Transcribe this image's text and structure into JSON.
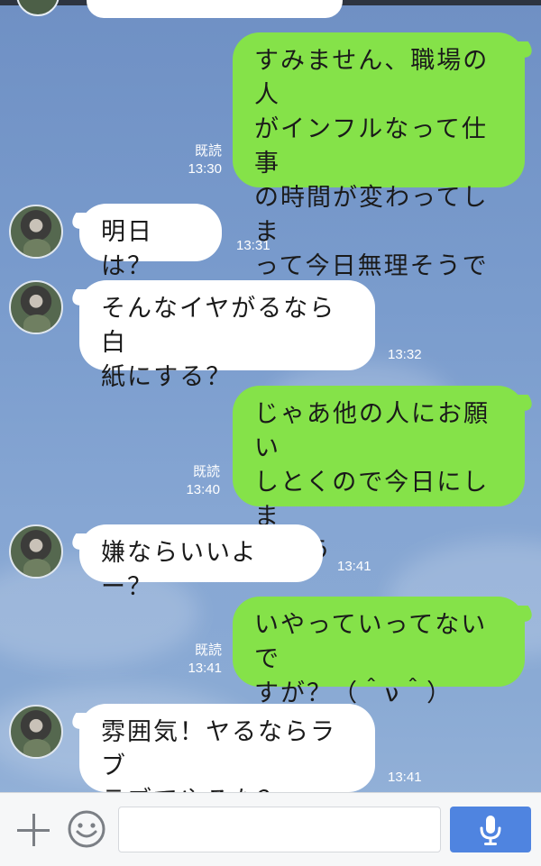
{
  "messages": [
    {
      "type": "out",
      "text": "すみません、職場の人\nがインフルなって仕事\nの時間が変わってしま\nって今日無理そうです",
      "read": "既読",
      "time": "13:30"
    },
    {
      "type": "in",
      "text": "明日は？",
      "time": "13:31"
    },
    {
      "type": "in",
      "text": "そんなイヤがるなら白\n紙にする？",
      "time": "13:32"
    },
    {
      "type": "out",
      "text": "じゃあ他の人にお願い\nしとくので今日にしま\nしょう",
      "read": "既読",
      "time": "13:40"
    },
    {
      "type": "in",
      "text": "嫌ならいいよー？",
      "time": "13:41"
    },
    {
      "type": "out",
      "text": "いやっていってないで\nすが？（＾ν＾）",
      "read": "既読",
      "time": "13:41"
    },
    {
      "type": "in",
      "text": "雰囲気！ヤるならラブ\nラブでやろな？",
      "time": "13:41"
    }
  ],
  "input": {
    "value": "",
    "icons": {
      "add": "plus-icon",
      "emoji": "smiley-icon",
      "voice": "microphone-icon"
    }
  },
  "colors": {
    "outgoing_bubble": "#85e249",
    "incoming_bubble": "#ffffff",
    "mic_button": "#4f84e0"
  }
}
